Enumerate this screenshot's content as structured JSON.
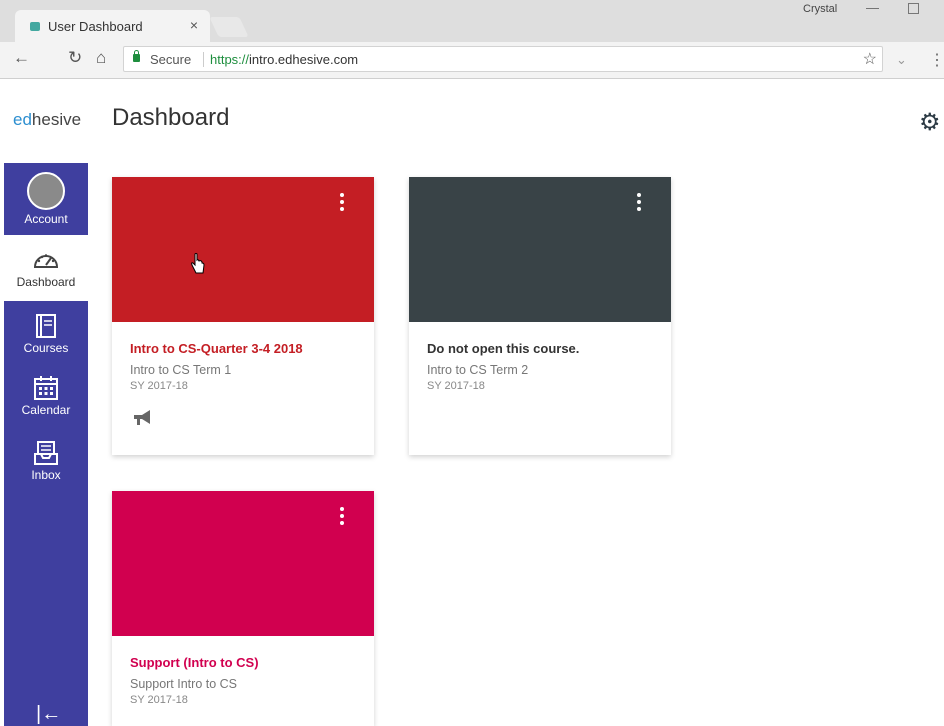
{
  "browser": {
    "tab_title": "User Dashboard",
    "tab_close": "×",
    "user_name": "Crystal",
    "secure_label": "Secure",
    "url_protocol": "https://",
    "url_host": "intro.edhesive.com",
    "star": "☆",
    "back": "←",
    "reload": "↻",
    "home": "⌂",
    "menu": "⋮",
    "minimize": "—"
  },
  "app": {
    "logo_prefix": "ed",
    "logo_suffix": "hesive",
    "page_title": "Dashboard",
    "settings_icon": "⚙"
  },
  "sidebar": {
    "accent": "#3f3f9f",
    "items": [
      {
        "label": "Account",
        "icon": "avatar"
      },
      {
        "label": "Dashboard",
        "icon": "speedometer-icon"
      },
      {
        "label": "Courses",
        "icon": "book-icon"
      },
      {
        "label": "Calendar",
        "icon": "calendar-icon"
      },
      {
        "label": "Inbox",
        "icon": "inbox-icon"
      }
    ],
    "collapse": "|←"
  },
  "cards": [
    {
      "color": "#c41e24",
      "title": "Intro to CS-Quarter 3-4 2018",
      "title_color": "#c41e24",
      "subtitle": "Intro to CS Term 1",
      "term": "SY 2017-18",
      "icon": "megaphone-icon"
    },
    {
      "color": "#394347",
      "title": "Do not open this course.",
      "title_color": "#333333",
      "subtitle": "Intro to CS Term 2",
      "term": "SY 2017-18"
    },
    {
      "color": "#d1004f",
      "title": "Support (Intro to CS)",
      "title_color": "#d1004f",
      "subtitle": "Support Intro to CS",
      "term": "SY 2017-18"
    }
  ]
}
